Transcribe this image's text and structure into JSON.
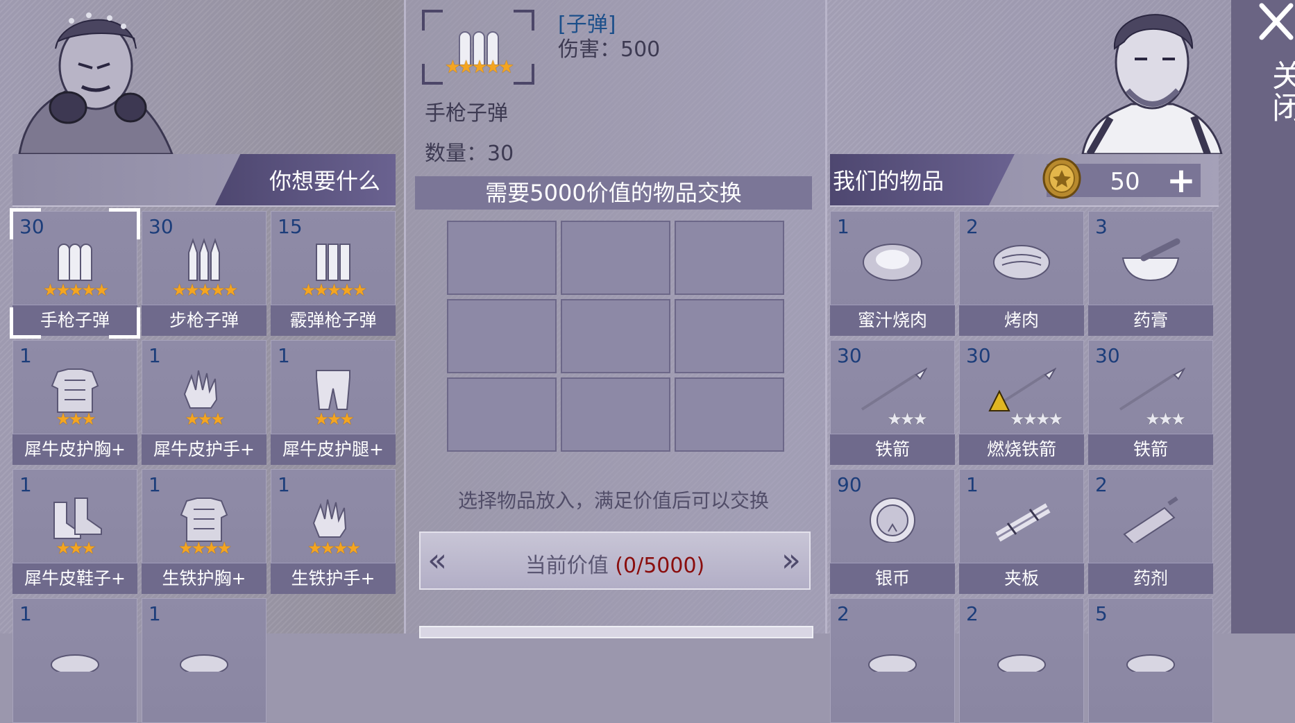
{
  "left": {
    "title": "你想要什么",
    "items": [
      {
        "count": "30",
        "label": "手枪子弹",
        "stars": 5,
        "icon": "pistol-bullets-icon",
        "selected": true
      },
      {
        "count": "30",
        "label": "步枪子弹",
        "stars": 5,
        "icon": "rifle-bullets-icon"
      },
      {
        "count": "15",
        "label": "霰弹枪子弹",
        "stars": 5,
        "icon": "shotgun-shells-icon"
      },
      {
        "count": "1",
        "label": "犀牛皮护胸+",
        "stars": 3,
        "icon": "chest-armor-icon"
      },
      {
        "count": "1",
        "label": "犀牛皮护手+",
        "stars": 3,
        "icon": "gloves-icon"
      },
      {
        "count": "1",
        "label": "犀牛皮护腿+",
        "stars": 3,
        "icon": "leg-armor-icon"
      },
      {
        "count": "1",
        "label": "犀牛皮鞋子+",
        "stars": 3,
        "icon": "boots-icon"
      },
      {
        "count": "1",
        "label": "生铁护胸+",
        "stars": 4,
        "icon": "iron-chest-icon"
      },
      {
        "count": "1",
        "label": "生铁护手+",
        "stars": 4,
        "icon": "iron-gloves-icon"
      },
      {
        "count": "1",
        "label": "",
        "stars": 0,
        "icon": "armor-icon"
      },
      {
        "count": "1",
        "label": "",
        "stars": 0,
        "icon": "item-icon"
      }
    ]
  },
  "detail": {
    "category": "[子弹]",
    "damage": "伤害：500",
    "name": "手枪子弹",
    "quantity": "数量：30",
    "stars": 5
  },
  "exchange": {
    "title": "需要5000价值的物品交换",
    "hint": "选择物品放入，满足价值后可以交换",
    "value_label": "当前价值 ",
    "value_num": "(0/5000)",
    "prev": "«",
    "next": "»"
  },
  "right": {
    "title": "我们的物品",
    "coins": "50",
    "plus": "+",
    "items": [
      {
        "count": "1",
        "label": "蜜汁烧肉",
        "icon": "honey-meat-icon"
      },
      {
        "count": "2",
        "label": "烤肉",
        "icon": "roast-meat-icon"
      },
      {
        "count": "3",
        "label": "药膏",
        "icon": "mortar-ointment-icon"
      },
      {
        "count": "30",
        "label": "铁箭",
        "stars": 3,
        "icon": "iron-arrow-icon"
      },
      {
        "count": "30",
        "label": "燃烧铁箭",
        "stars": 4,
        "icon": "fire-arrow-icon"
      },
      {
        "count": "30",
        "label": "铁箭",
        "stars": 3,
        "icon": "iron-arrow-icon"
      },
      {
        "count": "90",
        "label": "银币",
        "icon": "silver-coin-icon"
      },
      {
        "count": "1",
        "label": "夹板",
        "icon": "splint-icon"
      },
      {
        "count": "2",
        "label": "药剂",
        "icon": "syringe-icon"
      },
      {
        "count": "2",
        "label": "",
        "icon": "item-icon"
      },
      {
        "count": "2",
        "label": "",
        "icon": "item-icon"
      },
      {
        "count": "5",
        "label": "",
        "icon": "item-icon"
      }
    ]
  },
  "side": {
    "close_label": "关闭"
  }
}
